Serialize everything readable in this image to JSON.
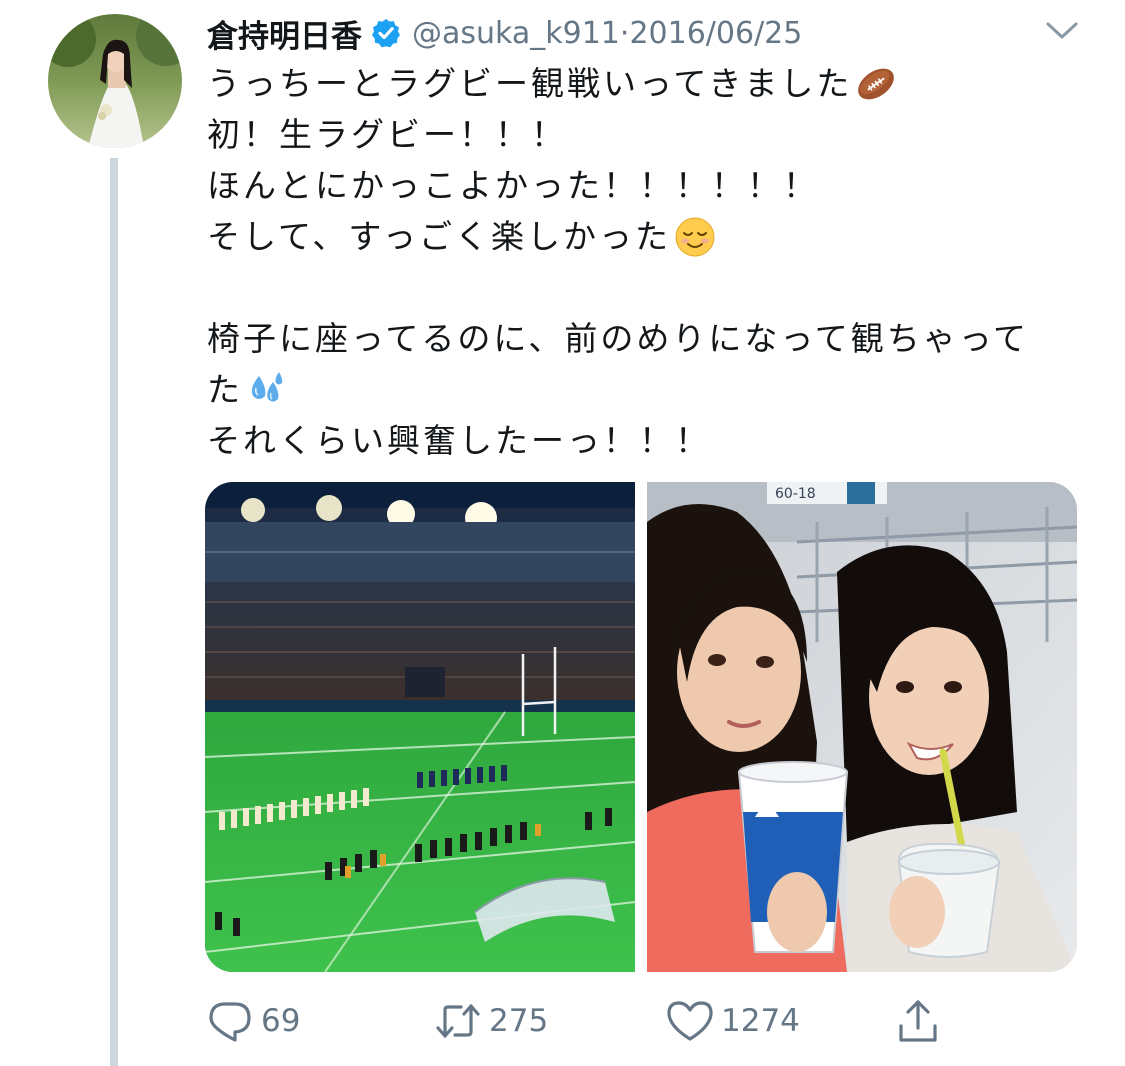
{
  "tweet": {
    "display_name": "倉持明日香",
    "handle": "@asuka_k911",
    "separator": "·",
    "date": "2016/06/25",
    "verified": true,
    "lines": [
      {
        "text": "うっちーとラグビー観戦いってきました",
        "emoji": "rugby-football"
      },
      {
        "text": "初！生ラグビー！！！"
      },
      {
        "text": "ほんとにかっこよかった！！！！！！"
      },
      {
        "text": "そして、すっごく楽しかった",
        "emoji": "relieved-smiling-face"
      },
      {
        "text": ""
      },
      {
        "text": "椅子に座ってるのに、前のめりになって観ちゃって"
      },
      {
        "text": "た",
        "emoji": "sweat-droplets"
      },
      {
        "text": "それくらい興奮したーっ！！！"
      }
    ],
    "media": [
      {
        "label": "stadium-photo",
        "stand_sign": ""
      },
      {
        "label": "selfie-photo",
        "stand_sign": "60-18"
      }
    ]
  },
  "actions": {
    "reply_count": "69",
    "retweet_count": "275",
    "like_count": "1274"
  },
  "colors": {
    "text": "#14171a",
    "secondary": "#657786",
    "verified": "#1da1f2",
    "thread_line": "#ccd6dd"
  },
  "icons": {
    "verified": "verified-badge-icon",
    "menu": "chevron-down-icon",
    "reply": "reply-icon",
    "retweet": "retweet-icon",
    "like": "heart-icon",
    "share": "share-icon"
  }
}
